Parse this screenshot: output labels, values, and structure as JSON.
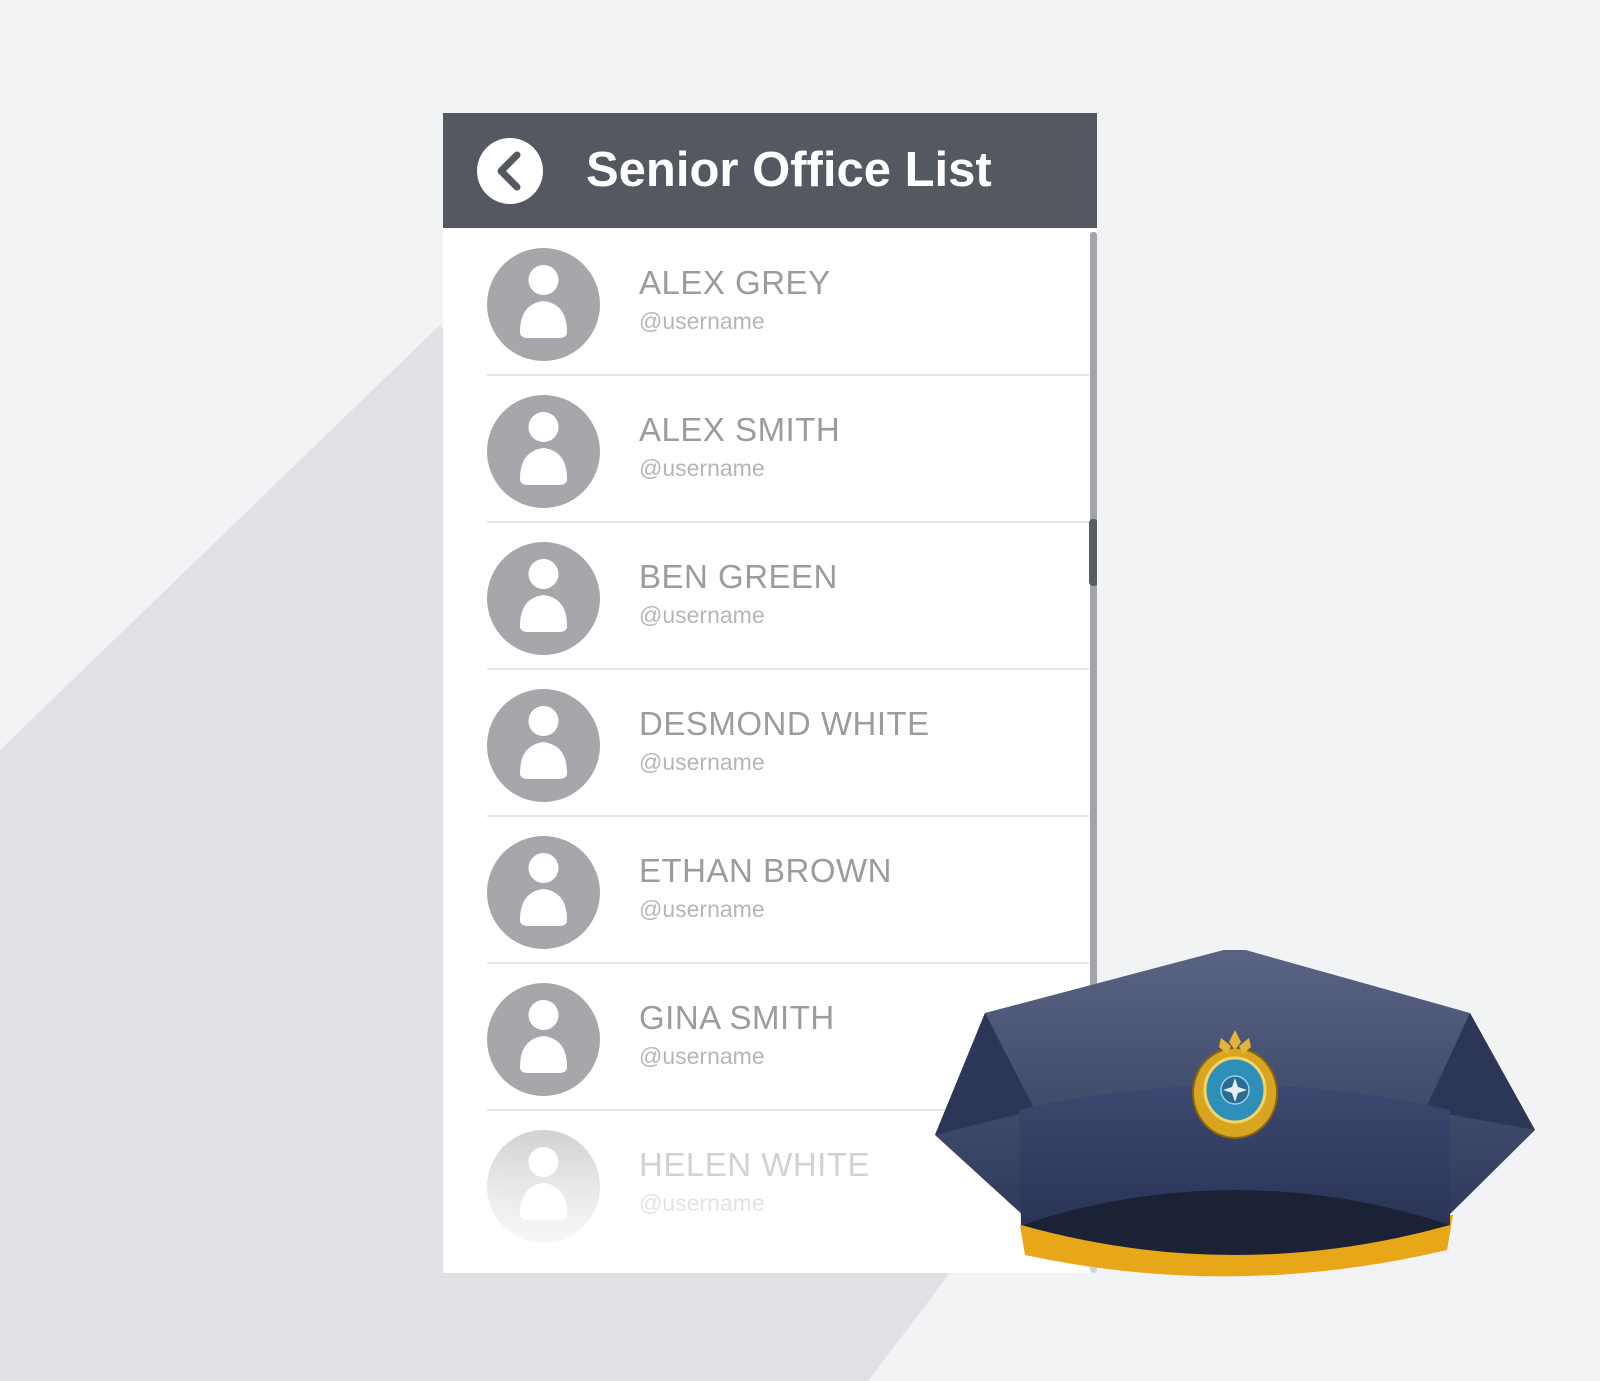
{
  "header": {
    "back_icon": "chevron-left-icon",
    "title": "Senior Office List"
  },
  "contacts": [
    {
      "name": "ALEX GREY",
      "handle": "@username"
    },
    {
      "name": "ALEX SMITH",
      "handle": "@username"
    },
    {
      "name": "BEN GREEN",
      "handle": "@username"
    },
    {
      "name": "DESMOND WHITE",
      "handle": "@username"
    },
    {
      "name": "ETHAN BROWN",
      "handle": "@username"
    },
    {
      "name": "GINA SMITH",
      "handle": "@username"
    },
    {
      "name": "HELEN WHITE",
      "handle": "@username"
    }
  ],
  "colors": {
    "header_bg": "#535861",
    "avatar": "#a6a7ab",
    "cap_navy": "#3b4668",
    "cap_band": "#e8a619"
  },
  "icons": {
    "avatar": "user-avatar-icon",
    "cap": "officer-cap-illustration"
  }
}
